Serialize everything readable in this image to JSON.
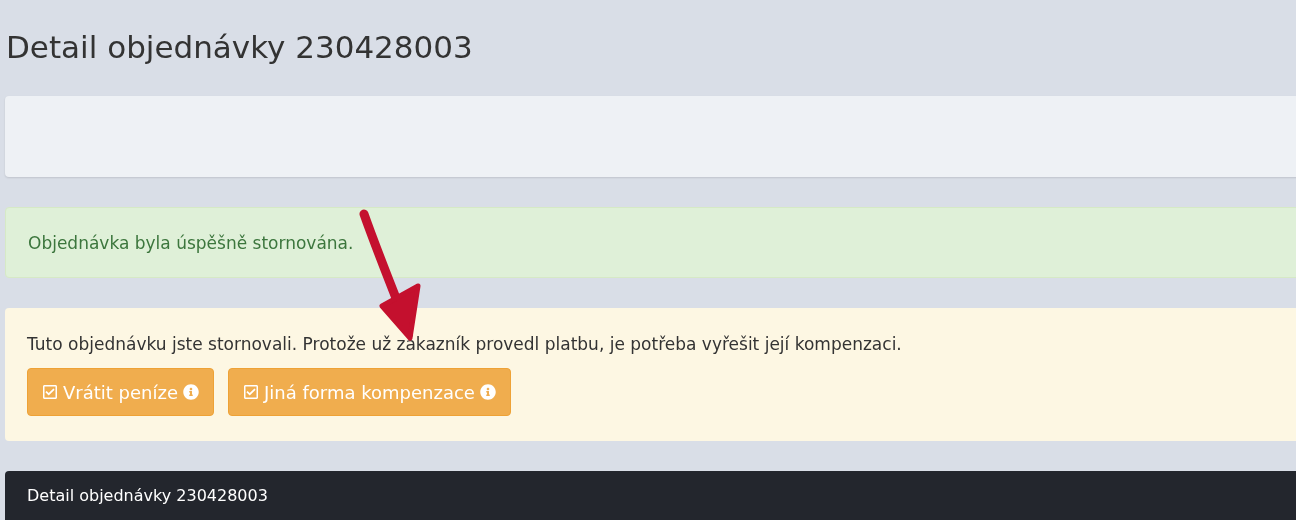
{
  "title": "Detail objednávky 230428003",
  "success_alert": {
    "text": "Objednávka byla úspěšně stornována."
  },
  "warning_alert": {
    "text": "Tuto objednávku jste stornovali. Protože už zákazník provedl platbu, je potřeba vyřešit její kompenzaci.",
    "buttons": [
      {
        "label": "Vrátit peníze"
      },
      {
        "label": "Jiná forma kompenzace"
      }
    ]
  },
  "dark_bar": {
    "title": "Detail objednávky 230428003"
  }
}
